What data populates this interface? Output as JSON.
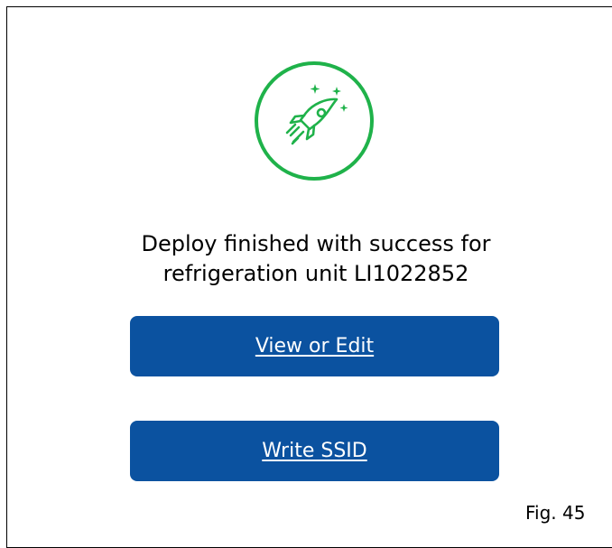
{
  "colors": {
    "accent": "#0b52a0",
    "success": "#1fb24a",
    "border": "#000000",
    "background": "#ffffff",
    "button_text": "#ffffff"
  },
  "status_icon": {
    "name": "rocket-icon",
    "ring_color": "#1fb24a"
  },
  "message": {
    "line1": "Deploy finished with success for",
    "line2": "refrigeration unit LI1022852"
  },
  "buttons": {
    "view_or_edit": "View or Edit",
    "write_ssid": "Write SSID"
  },
  "caption": "Fig. 45"
}
